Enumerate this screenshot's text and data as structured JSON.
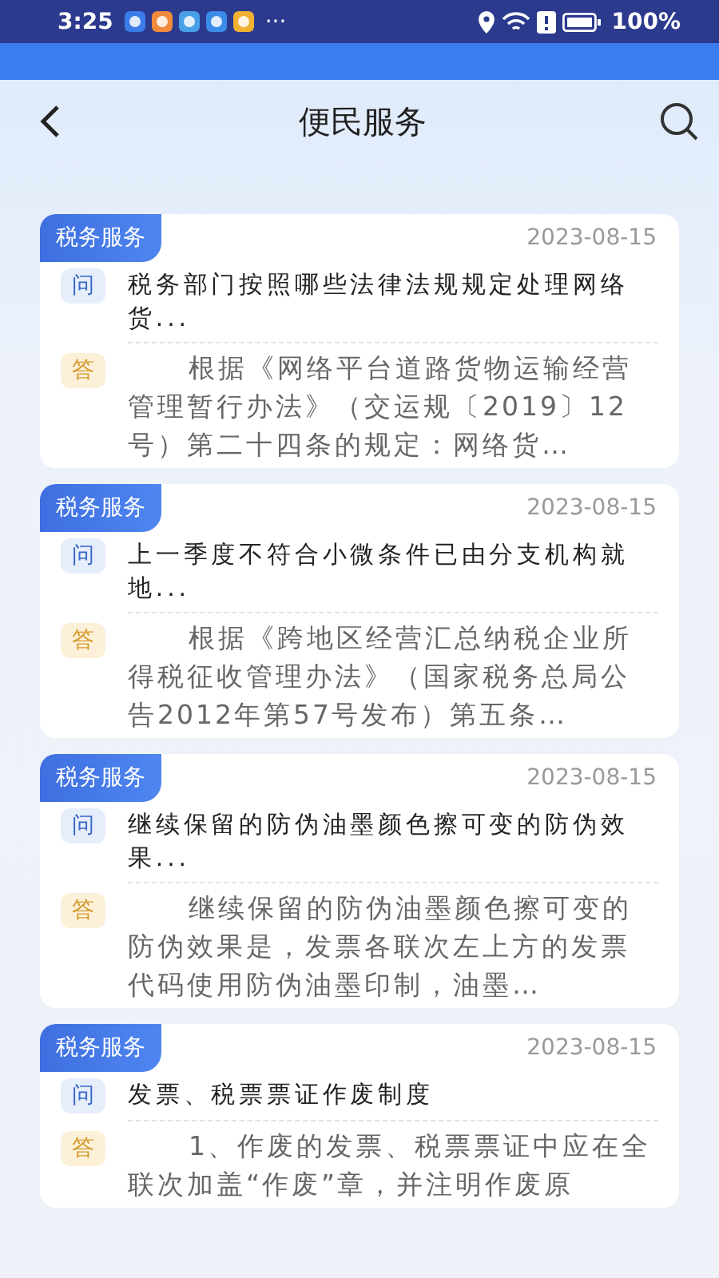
{
  "status_bar": {
    "time": "3:25",
    "more": "···",
    "battery": "100%"
  },
  "header": {
    "title": "便民服务"
  },
  "cards": [
    {
      "category": "税务服务",
      "date": "2023-08-15",
      "question_badge": "问",
      "question": "税务部门按照哪些法律法规规定处理网络货...",
      "answer_badge": "答",
      "answer": "根据《网络平台道路货物运输经营管理暂行办法》（交运规〔2019〕12号）第二十四条的规定：网络货…"
    },
    {
      "category": "税务服务",
      "date": "2023-08-15",
      "question_badge": "问",
      "question": "上一季度不符合小微条件已由分支机构就地...",
      "answer_badge": "答",
      "answer": "根据《跨地区经营汇总纳税企业所得税征收管理办法》（国家税务总局公告2012年第57号发布）第五条…"
    },
    {
      "category": "税务服务",
      "date": "2023-08-15",
      "question_badge": "问",
      "question": "继续保留的防伪油墨颜色擦可变的防伪效果...",
      "answer_badge": "答",
      "answer": "继续保留的防伪油墨颜色擦可变的防伪效果是，发票各联次左上方的发票代码使用防伪油墨印制，油墨…"
    },
    {
      "category": "税务服务",
      "date": "2023-08-15",
      "question_badge": "问",
      "question": "发票、税票票证作废制度",
      "answer_badge": "答",
      "answer": "1、作废的发票、税票票证中应在全联次加盖“作废”章，并注明作废原"
    }
  ]
}
